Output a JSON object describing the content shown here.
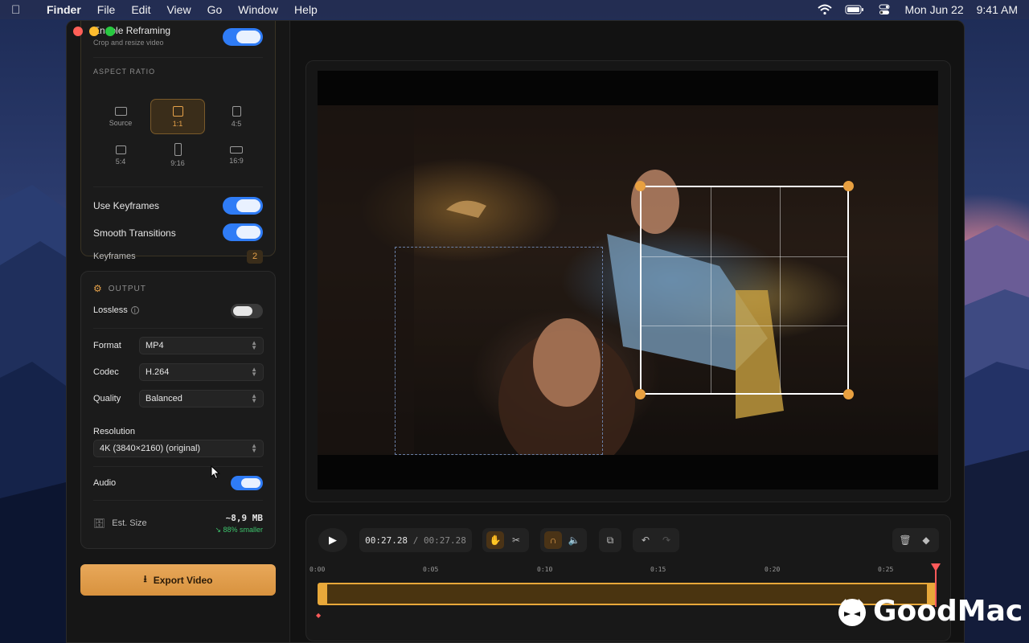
{
  "menubar": {
    "app": "Finder",
    "items": [
      "File",
      "Edit",
      "View",
      "Go",
      "Window",
      "Help"
    ],
    "date": "Mon Jun 22",
    "time": "9:41 AM"
  },
  "reframing": {
    "title": "Enable Reframing",
    "subtitle": "Crop and resize video",
    "enabled": true,
    "aspect_ratio_label": "ASPECT RATIO",
    "ratios": [
      "Source",
      "1:1",
      "4:5",
      "5:4",
      "9:16",
      "16:9"
    ],
    "selected_ratio": "1:1",
    "use_keyframes_label": "Use Keyframes",
    "use_keyframes": true,
    "smooth_transitions_label": "Smooth Transitions",
    "smooth_transitions": true,
    "keyframes_label": "Keyframes",
    "keyframes_count": "2"
  },
  "output": {
    "heading": "OUTPUT",
    "lossless_label": "Lossless",
    "lossless": false,
    "format_label": "Format",
    "format_value": "MP4",
    "codec_label": "Codec",
    "codec_value": "H.264",
    "quality_label": "Quality",
    "quality_value": "Balanced",
    "resolution_label": "Resolution",
    "resolution_value": "4K (3840×2160) (original)",
    "audio_label": "Audio",
    "audio": true,
    "est_size_label": "Est. Size",
    "est_size_value": "~8,9 MB",
    "est_size_delta": "↘ 88% smaller"
  },
  "export_label": "Export Video",
  "player": {
    "current_time": "00:27.28",
    "total_time": "00:27.28",
    "ruler_ticks": [
      "0:00",
      "0:05",
      "0:10",
      "0:15",
      "0:20",
      "0:25"
    ]
  },
  "watermark": "GoodMac",
  "colors": {
    "accent": "#e8a83a",
    "toggle_on": "#2f7cf6",
    "playhead": "#ff5a5a"
  }
}
